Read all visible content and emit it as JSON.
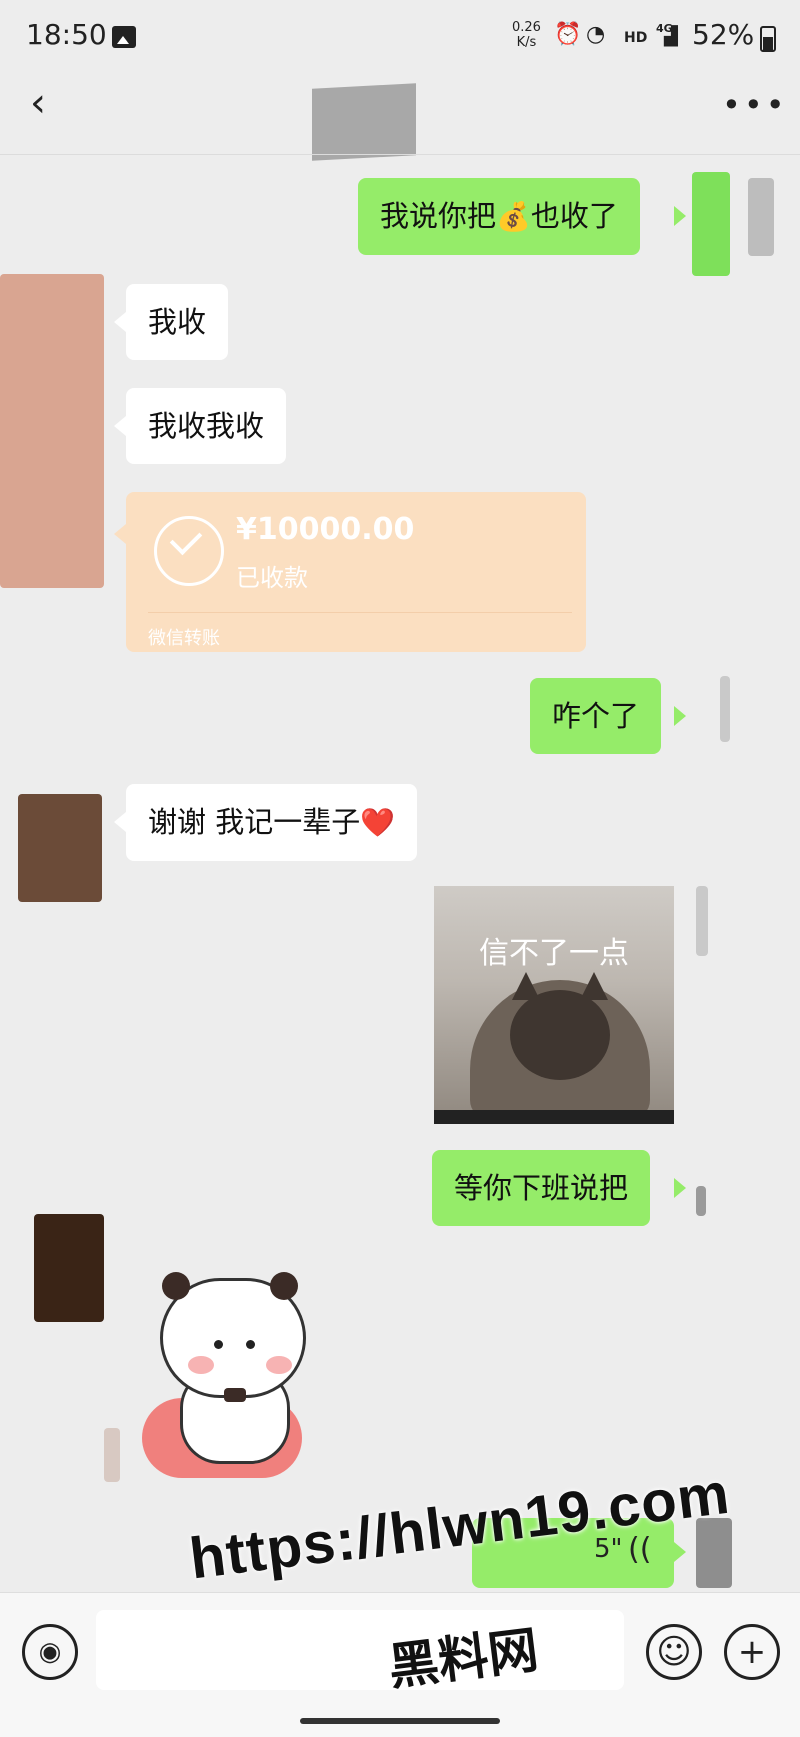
{
  "status_bar": {
    "time": "18:50",
    "net_speed_value": "0.26",
    "net_speed_unit": "K/s",
    "hd_label": "HD",
    "network_label": "4G",
    "battery": "52%"
  },
  "header": {
    "back_glyph": "‹",
    "more_glyph": "•••"
  },
  "messages": [
    {
      "from": "me",
      "type": "text",
      "text_before": "我说你把",
      "emoji": "💰",
      "text_after": "也收了"
    },
    {
      "from": "them",
      "type": "text",
      "text": "我收"
    },
    {
      "from": "them",
      "type": "text",
      "text": "我收我收"
    },
    {
      "from": "them",
      "type": "transfer",
      "amount": "¥10000.00",
      "status": "已收款",
      "footer": "微信转账"
    },
    {
      "from": "me",
      "type": "text",
      "text": "咋个了"
    },
    {
      "from": "them",
      "type": "text",
      "text": "谢谢 我记一辈子",
      "emoji": "❤️"
    },
    {
      "from": "me",
      "type": "image",
      "caption": "信不了一点"
    },
    {
      "from": "me",
      "type": "text",
      "text": "等你下班说把"
    },
    {
      "from": "them",
      "type": "sticker"
    },
    {
      "from": "me",
      "type": "voice",
      "duration": "5\""
    }
  ],
  "input_bar": {
    "voice_glyph": "◉",
    "emoji_glyph": "☺",
    "plus_glyph": "+"
  },
  "watermark": {
    "url": "https://hlwn19.com",
    "name": "黑料网"
  },
  "colors": {
    "my_bubble": "#95ec69",
    "their_bubble": "#ffffff",
    "transfer_card": "#fbdfc1",
    "background": "#ededed"
  }
}
